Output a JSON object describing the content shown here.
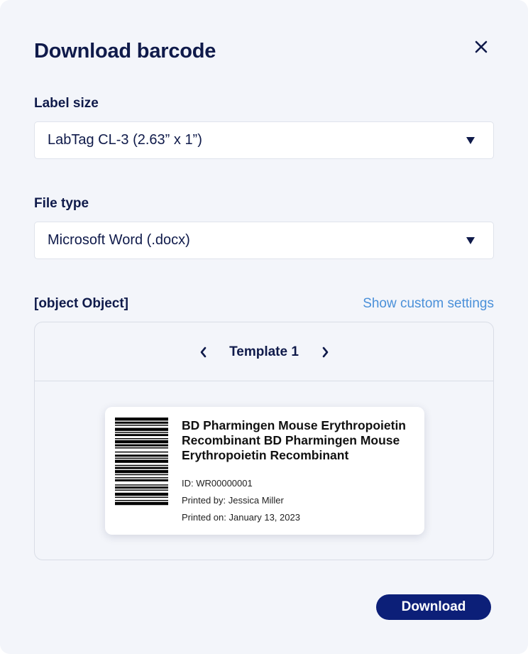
{
  "dialog": {
    "title": "Download barcode",
    "close_icon": "close-icon"
  },
  "label_size": {
    "label": "Label size",
    "selected": "LabTag CL-3 (2.63” x 1”)"
  },
  "file_type": {
    "label": "File type",
    "selected": "Microsoft Word (.docx)"
  },
  "preview": {
    "label": {
      "product_name": "BD Pharmingen Mouse Erythropoietin Recombinant BD Pharmingen Mouse Erythropoietin Recombinant",
      "id": "ID: WR00000001",
      "printed_by": "Printed by: Jessica Miller",
      "printed_on": "Printed on: January 13,  2023"
    },
    "custom_settings_link": "Show custom settings",
    "template_name": "Template 1"
  },
  "actions": {
    "download_label": "Download"
  },
  "colors": {
    "primary": "#0c1f78",
    "text": "#0f1a4a",
    "link": "#4a90d9",
    "background": "#f3f5fa"
  }
}
